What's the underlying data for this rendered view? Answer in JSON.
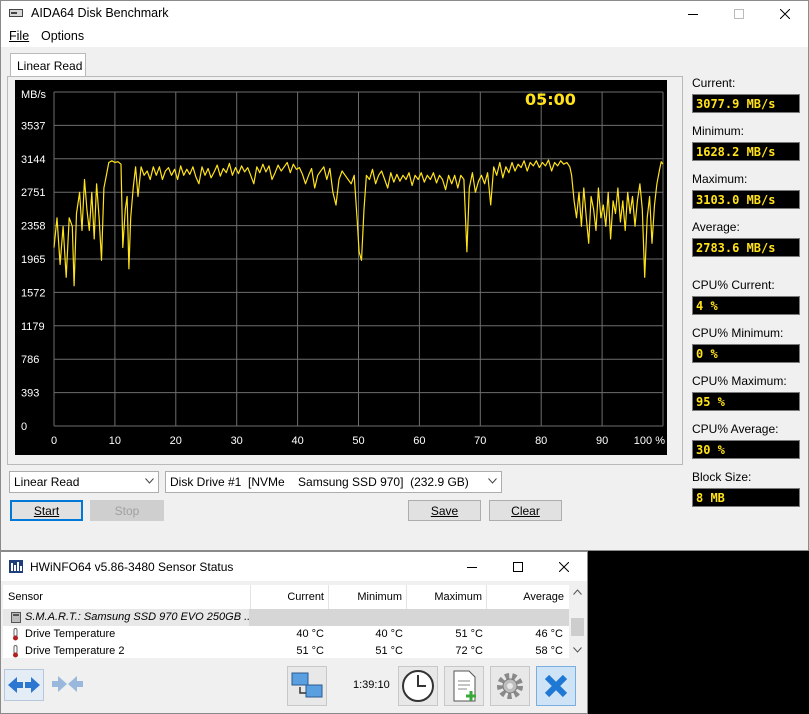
{
  "aida": {
    "title": "AIDA64 Disk Benchmark",
    "menu": [
      "File",
      "Options"
    ],
    "tab": "Linear Read",
    "timer": "05:00",
    "stats": {
      "current_label": "Current:",
      "current": "3077.9 MB/s",
      "minimum_label": "Minimum:",
      "minimum": "1628.2 MB/s",
      "maximum_label": "Maximum:",
      "maximum": "3103.0 MB/s",
      "average_label": "Average:",
      "average": "2783.6 MB/s",
      "cpu_current_label": "CPU% Current:",
      "cpu_current": "4 %",
      "cpu_minimum_label": "CPU% Minimum:",
      "cpu_minimum": "0 %",
      "cpu_maximum_label": "CPU% Maximum:",
      "cpu_maximum": "95 %",
      "cpu_average_label": "CPU% Average:",
      "cpu_average": "30 %",
      "block_size_label": "Block Size:",
      "block_size": "8 MB"
    },
    "test_select": "Linear Read",
    "drive_select": "Disk Drive #1  [NVMe    Samsung SSD 970]  (232.9 GB)",
    "buttons": {
      "start": "Start",
      "stop": "Stop",
      "save": "Save",
      "clear": "Clear"
    },
    "colors": {
      "plot_bg": "#000000",
      "grid": "#6e6e6e",
      "series": "#ffe21a",
      "labels": "#ffffff"
    }
  },
  "chart_data": {
    "type": "line",
    "ylabel": "MB/s",
    "y_ticks": [
      "3537",
      "3144",
      "2751",
      "2358",
      "1965",
      "1572",
      "1179",
      "786",
      "393",
      "0"
    ],
    "x_ticks": [
      "0",
      "10",
      "20",
      "30",
      "40",
      "50",
      "60",
      "70",
      "80",
      "90",
      "100 %"
    ],
    "xlim": [
      0,
      100
    ],
    "ylim": [
      0,
      3930
    ],
    "grid": true,
    "series": [
      {
        "color": "#ffe21a",
        "points": [
          [
            0.0,
            2100
          ],
          [
            0.5,
            2450
          ],
          [
            1.0,
            1900
          ],
          [
            1.5,
            2350
          ],
          [
            2.0,
            1750
          ],
          [
            2.5,
            2450
          ],
          [
            3.0,
            2350
          ],
          [
            3.3,
            1650
          ],
          [
            3.7,
            2500
          ],
          [
            4.2,
            2750
          ],
          [
            4.6,
            2300
          ],
          [
            5.0,
            2900
          ],
          [
            5.4,
            2550
          ],
          [
            5.8,
            2300
          ],
          [
            6.2,
            2750
          ],
          [
            6.6,
            2200
          ],
          [
            7.0,
            2850
          ],
          [
            7.4,
            2450
          ],
          [
            7.8,
            1950
          ],
          [
            8.2,
            2800
          ],
          [
            8.6,
            2950
          ],
          [
            9.0,
            3100
          ],
          [
            9.5,
            3120
          ],
          [
            10.0,
            3100
          ],
          [
            10.5,
            3110
          ],
          [
            11.0,
            3080
          ],
          [
            11.3,
            2100
          ],
          [
            11.7,
            2550
          ],
          [
            12.0,
            2700
          ],
          [
            12.3,
            1850
          ],
          [
            12.6,
            2450
          ],
          [
            13.0,
            2800
          ],
          [
            13.4,
            3050
          ],
          [
            13.8,
            2700
          ],
          [
            14.3,
            3050
          ],
          [
            14.8,
            2950
          ],
          [
            15.3,
            3000
          ],
          [
            15.8,
            2900
          ],
          [
            16.3,
            3050
          ],
          [
            16.8,
            2950
          ],
          [
            17.3,
            3050
          ],
          [
            17.8,
            2900
          ],
          [
            18.3,
            3000
          ],
          [
            18.8,
            3040
          ],
          [
            19.3,
            2950
          ],
          [
            19.8,
            3020
          ],
          [
            20.3,
            2900
          ],
          [
            20.8,
            3060
          ],
          [
            21.3,
            2950
          ],
          [
            21.8,
            3020
          ],
          [
            22.3,
            2960
          ],
          [
            22.8,
            3050
          ],
          [
            23.3,
            2930
          ],
          [
            23.8,
            2850
          ],
          [
            24.3,
            3050
          ],
          [
            24.8,
            2950
          ],
          [
            25.3,
            3030
          ],
          [
            25.8,
            2920
          ],
          [
            26.3,
            2990
          ],
          [
            26.8,
            3070
          ],
          [
            27.3,
            2940
          ],
          [
            27.8,
            3030
          ],
          [
            28.3,
            2980
          ],
          [
            28.8,
            3090
          ],
          [
            29.3,
            2950
          ],
          [
            29.8,
            3040
          ],
          [
            30.3,
            2970
          ],
          [
            30.8,
            3060
          ],
          [
            31.3,
            2990
          ],
          [
            31.8,
            3040
          ],
          [
            32.3,
            2950
          ],
          [
            32.8,
            2850
          ],
          [
            33.3,
            3050
          ],
          [
            33.8,
            2980
          ],
          [
            34.3,
            3080
          ],
          [
            34.8,
            2990
          ],
          [
            35.3,
            3060
          ],
          [
            35.8,
            2900
          ],
          [
            36.3,
            2980
          ],
          [
            36.8,
            3070
          ],
          [
            37.3,
            3000
          ],
          [
            37.8,
            3050
          ],
          [
            38.3,
            3100
          ],
          [
            38.8,
            2980
          ],
          [
            39.3,
            3080
          ],
          [
            39.8,
            3020
          ],
          [
            40.3,
            3040
          ],
          [
            40.8,
            2960
          ],
          [
            41.3,
            2850
          ],
          [
            41.8,
            2950
          ],
          [
            42.3,
            3030
          ],
          [
            42.8,
            2800
          ],
          [
            43.3,
            2950
          ],
          [
            43.8,
            3000
          ],
          [
            44.3,
            3050
          ],
          [
            44.8,
            2900
          ],
          [
            45.3,
            3030
          ],
          [
            45.8,
            2750
          ],
          [
            46.3,
            2600
          ],
          [
            46.8,
            2900
          ],
          [
            47.3,
            3000
          ],
          [
            47.8,
            2950
          ],
          [
            48.3,
            2900
          ],
          [
            48.8,
            2850
          ],
          [
            49.3,
            2950
          ],
          [
            49.8,
            2400
          ],
          [
            50.1,
            2050
          ],
          [
            50.5,
            1950
          ],
          [
            50.9,
            2550
          ],
          [
            51.3,
            2950
          ],
          [
            51.8,
            2900
          ],
          [
            52.3,
            3020
          ],
          [
            52.8,
            2850
          ],
          [
            53.3,
            2950
          ],
          [
            53.8,
            3000
          ],
          [
            54.3,
            2900
          ],
          [
            54.8,
            2800
          ],
          [
            55.3,
            2980
          ],
          [
            55.8,
            2870
          ],
          [
            56.3,
            2960
          ],
          [
            56.8,
            2880
          ],
          [
            57.3,
            2950
          ],
          [
            57.8,
            2900
          ],
          [
            58.3,
            2980
          ],
          [
            58.8,
            2830
          ],
          [
            59.3,
            2950
          ],
          [
            59.8,
            2900
          ],
          [
            60.3,
            2980
          ],
          [
            60.8,
            2870
          ],
          [
            61.3,
            2950
          ],
          [
            61.8,
            2900
          ],
          [
            62.3,
            2980
          ],
          [
            62.8,
            2860
          ],
          [
            63.3,
            2950
          ],
          [
            63.8,
            2900
          ],
          [
            64.3,
            2780
          ],
          [
            64.8,
            2950
          ],
          [
            65.3,
            2850
          ],
          [
            65.8,
            2950
          ],
          [
            66.3,
            2800
          ],
          [
            66.8,
            2950
          ],
          [
            67.3,
            2900
          ],
          [
            67.8,
            2050
          ],
          [
            68.2,
            2800
          ],
          [
            68.7,
            2980
          ],
          [
            69.2,
            2750
          ],
          [
            69.7,
            2880
          ],
          [
            70.2,
            2950
          ],
          [
            70.7,
            2850
          ],
          [
            71.2,
            2980
          ],
          [
            71.7,
            2600
          ],
          [
            72.2,
            3050
          ],
          [
            72.7,
            2950
          ],
          [
            73.2,
            3100
          ],
          [
            73.7,
            2920
          ],
          [
            74.2,
            3050
          ],
          [
            74.7,
            2980
          ],
          [
            75.2,
            3100
          ],
          [
            75.7,
            3000
          ],
          [
            76.2,
            3080
          ],
          [
            76.7,
            3040
          ],
          [
            77.2,
            3120
          ],
          [
            77.7,
            3000
          ],
          [
            78.2,
            3100
          ],
          [
            78.7,
            3060
          ],
          [
            79.2,
            3120
          ],
          [
            79.7,
            3040
          ],
          [
            80.2,
            3100
          ],
          [
            80.7,
            3060
          ],
          [
            81.2,
            3130
          ],
          [
            81.7,
            3000
          ],
          [
            82.2,
            3100
          ],
          [
            82.7,
            3060
          ],
          [
            83.2,
            3120
          ],
          [
            83.7,
            3080
          ],
          [
            84.2,
            3100
          ],
          [
            84.7,
            3050
          ],
          [
            85.0,
            2950
          ],
          [
            85.4,
            2650
          ],
          [
            85.8,
            2450
          ],
          [
            86.2,
            2750
          ],
          [
            86.6,
            2350
          ],
          [
            87.0,
            2800
          ],
          [
            87.4,
            2450
          ],
          [
            87.8,
            2150
          ],
          [
            88.2,
            2700
          ],
          [
            88.6,
            2550
          ],
          [
            89.0,
            2300
          ],
          [
            89.4,
            2800
          ],
          [
            89.8,
            2450
          ],
          [
            90.2,
            2600
          ],
          [
            90.6,
            2350
          ],
          [
            91.0,
            2750
          ],
          [
            91.4,
            2200
          ],
          [
            91.8,
            2650
          ],
          [
            92.2,
            2500
          ],
          [
            92.6,
            2800
          ],
          [
            93.0,
            2400
          ],
          [
            93.4,
            2650
          ],
          [
            93.8,
            2300
          ],
          [
            94.2,
            2750
          ],
          [
            94.6,
            2500
          ],
          [
            95.0,
            2700
          ],
          [
            95.4,
            2350
          ],
          [
            95.8,
            2650
          ],
          [
            96.2,
            2850
          ],
          [
            96.6,
            2550
          ],
          [
            97.0,
            1750
          ],
          [
            97.4,
            2450
          ],
          [
            97.8,
            2700
          ],
          [
            98.2,
            2150
          ],
          [
            98.6,
            2600
          ],
          [
            99.0,
            2850
          ],
          [
            99.4,
            3000
          ],
          [
            99.7,
            3110
          ],
          [
            100.0,
            3080
          ]
        ]
      }
    ]
  },
  "hwinfo": {
    "title": "HWiNFO64 v5.86-3480 Sensor Status",
    "columns": [
      "Sensor",
      "Current",
      "Minimum",
      "Maximum",
      "Average"
    ],
    "group": "S.M.A.R.T.: Samsung SSD 970 EVO 250GB ...",
    "rows": [
      {
        "name": "Drive Temperature",
        "current": "40 °C",
        "minimum": "40 °C",
        "maximum": "51 °C",
        "average": "46 °C"
      },
      {
        "name": "Drive Temperature 2",
        "current": "51 °C",
        "minimum": "51 °C",
        "maximum": "72 °C",
        "average": "58 °C"
      }
    ],
    "elapsed": "1:39:10"
  }
}
